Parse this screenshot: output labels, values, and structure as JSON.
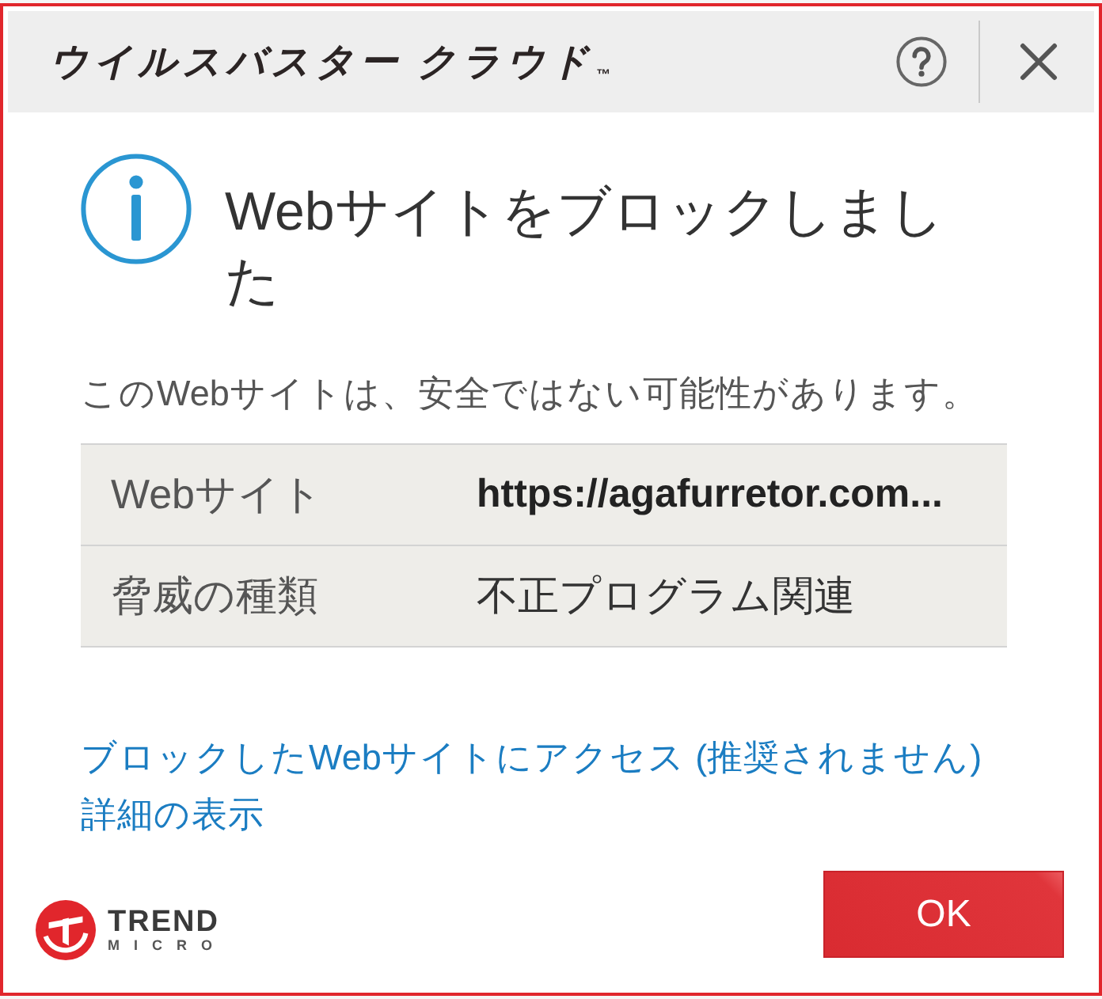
{
  "window": {
    "title": "ウイルスバスター クラウド",
    "trademark": "™"
  },
  "message": {
    "heading": "Webサイトをブロックしました",
    "description": "このWebサイトは、安全ではない可能性があります。"
  },
  "details": [
    {
      "kind": "url",
      "label": "Webサイト",
      "value": "https://agafurretor.com..."
    },
    {
      "kind": "text",
      "label": "脅威の種類",
      "value": "不正プログラム関連"
    }
  ],
  "links": [
    "ブロックしたWebサイトにアクセス (推奨されません)",
    "詳細の表示"
  ],
  "footer": {
    "brand": {
      "line_1": "TREND",
      "line_2": "MICRO"
    },
    "button": "OK"
  }
}
